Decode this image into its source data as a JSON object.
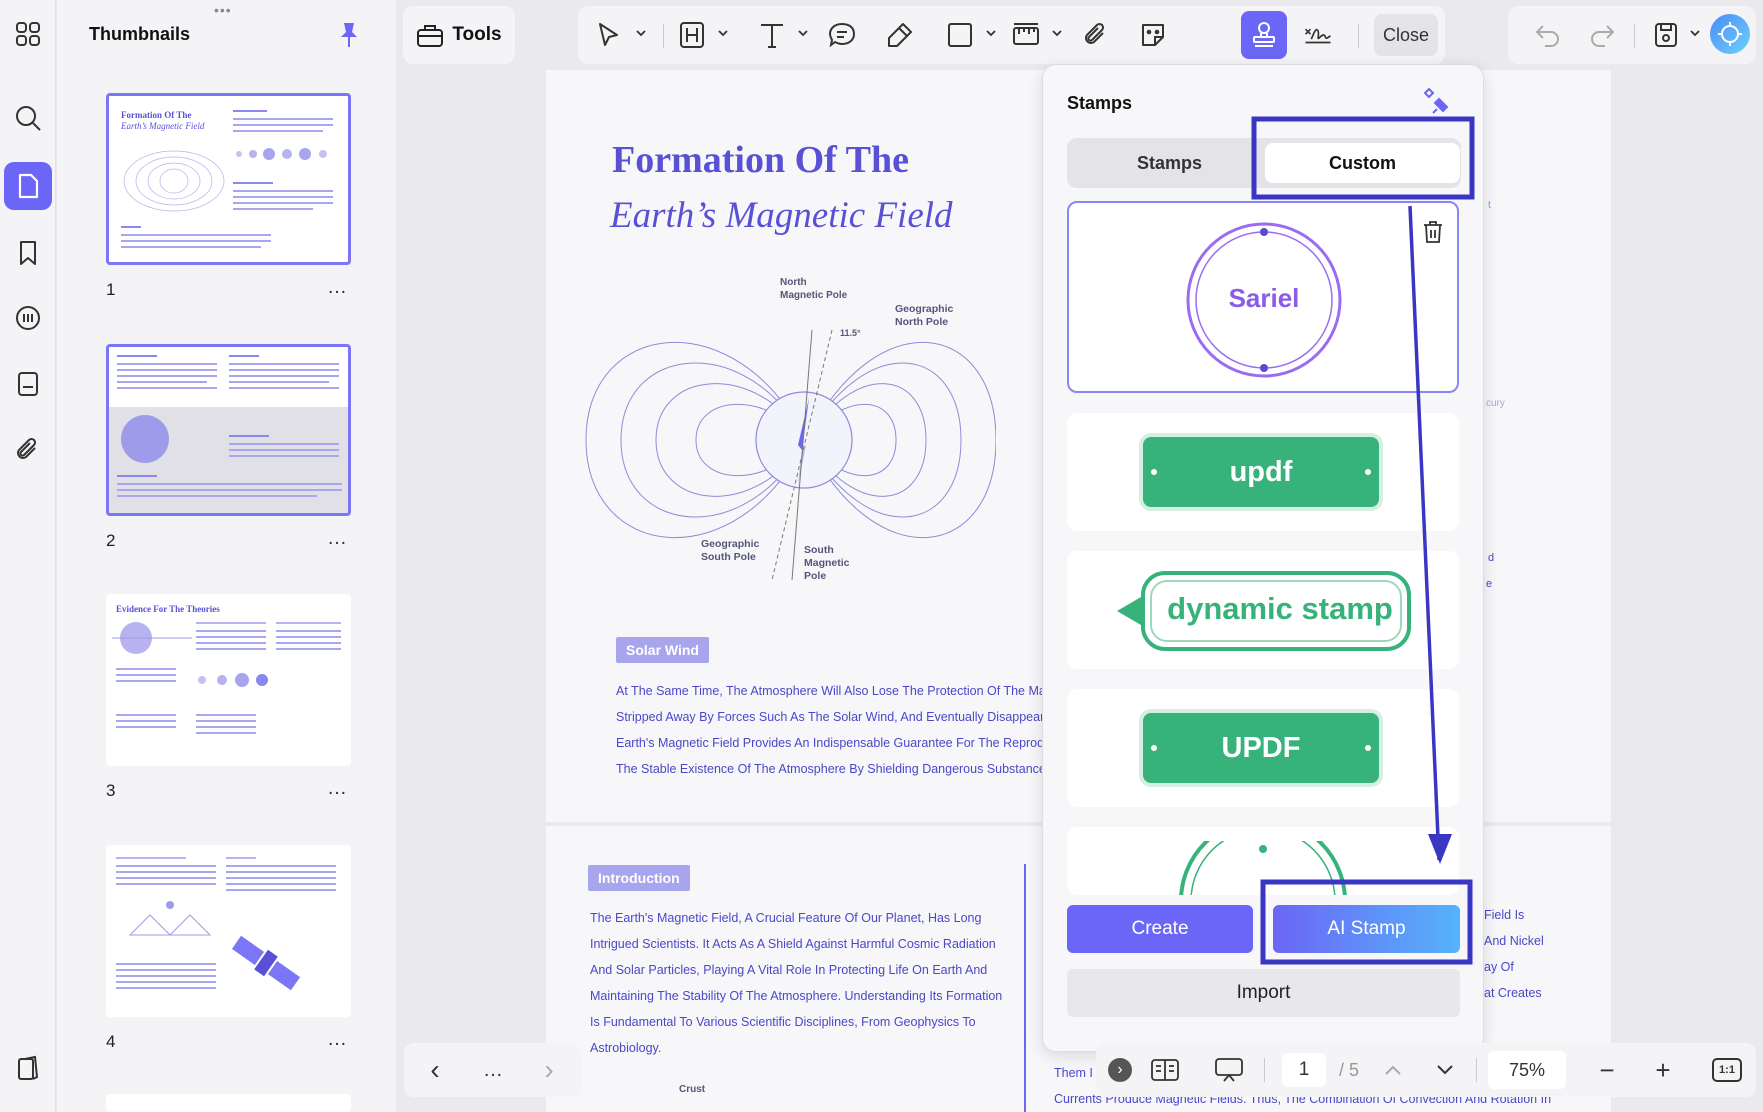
{
  "sidebar": {
    "title": "Thumbnails",
    "pages": [
      {
        "number": "1",
        "more": "…"
      },
      {
        "number": "2",
        "more": "…"
      },
      {
        "number": "3",
        "more": "…"
      },
      {
        "number": "4",
        "more": "…"
      }
    ],
    "thumb3_title": "Evidence For The Theories"
  },
  "toolbar": {
    "tools_label": "Tools",
    "close_label": "Close"
  },
  "document": {
    "title_line1": "Formation Of The",
    "title_line2": "Earth’s Magnetic Field",
    "diagram_labels": {
      "north_magnetic": "North\nMagnetic Pole",
      "geo_north": "Geographic\nNorth Pole",
      "angle": "11.5°",
      "geo_south": "Geographic\nSouth Pole",
      "south_magnetic": "South\nMagnetic\nPole"
    },
    "solar_wind_tag": "Solar Wind",
    "solar_wind_lines": [
      "At The Same Time, The Atmosphere Will Also Lose The Protection Of The Mag",
      "Stripped Away By Forces Such As The Solar Wind, And Eventually Disappear. I",
      "Earth's Magnetic Field Provides An Indispensable Guarantee For The Reproduc",
      "The Stable Existence Of The Atmosphere By Shielding Dangerous Substances"
    ],
    "intro_tag": "Introduction",
    "intro_lines": [
      "The Earth's Magnetic Field, A Crucial Feature Of Our Planet, Has Long",
      "Intrigued Scientists. It Acts As A Shield Against Harmful Cosmic Radiation",
      "And Solar Particles, Playing A Vital Role In Protecting Life On Earth And",
      "Maintaining The Stability Of The Atmosphere. Understanding Its Formation",
      "Is Fundamental To Various Scientific Disciplines, From Geophysics To",
      "Astrobiology."
    ],
    "crust_label": "Crust",
    "right_fragments": [
      "Field Is",
      "And Nickel",
      "ay Of",
      "at Creates"
    ],
    "right_top_fragments": [
      "t",
      "cury",
      "d",
      "e"
    ],
    "bottom_fragment_1": "Them I",
    "bottom_fragment_2": "Currents Produce Magnetic Fields. Thus, The Combination Of Convection And Rotation In"
  },
  "stamps_panel": {
    "title": "Stamps",
    "tabs": [
      "Stamps",
      "Custom"
    ],
    "active_tab": "Custom",
    "items": [
      {
        "label": "Sariel",
        "style": "circle"
      },
      {
        "label": "updf",
        "style": "pill"
      },
      {
        "label": "dynamic stamp",
        "style": "arrow"
      },
      {
        "label": "UPDF",
        "style": "pill"
      }
    ],
    "create_label": "Create",
    "ai_label": "AI Stamp",
    "import_label": "Import"
  },
  "bottom_bar": {
    "prev": "‹",
    "dots": "…",
    "next": "›",
    "page_current": "1",
    "page_total": "/ 5",
    "zoom": "75%",
    "fit_label": "1:1",
    "zoom_out": "−",
    "zoom_in": "+"
  },
  "colors": {
    "accent": "#6b66f5",
    "stamp_green": "#36b27a",
    "doc_text": "#4a47c8",
    "annotation": "#3a36c4"
  }
}
